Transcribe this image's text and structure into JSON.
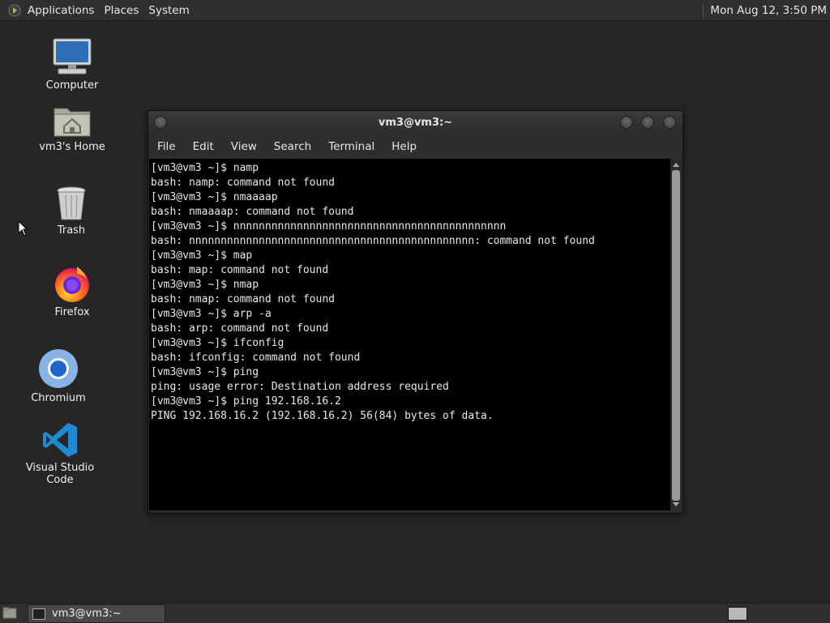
{
  "top_panel": {
    "menus": [
      "Applications",
      "Places",
      "System"
    ],
    "clock": "Mon Aug 12,  3:50 PM"
  },
  "desktop": {
    "icons": [
      {
        "label": "Computer",
        "icon": "computer-icon"
      },
      {
        "label": "vm3's Home",
        "icon": "home-folder-icon"
      },
      {
        "label": "Trash",
        "icon": "trash-icon"
      },
      {
        "label": "Firefox",
        "icon": "firefox-icon"
      },
      {
        "label": "Chromium",
        "icon": "chromium-icon"
      },
      {
        "label": "Visual Studio Code",
        "icon": "vscode-icon"
      }
    ]
  },
  "terminal": {
    "title": "vm3@vm3:~",
    "menu": [
      "File",
      "Edit",
      "View",
      "Search",
      "Terminal",
      "Help"
    ],
    "lines": [
      "[vm3@vm3 ~]$ namp",
      "bash: namp: command not found",
      "[vm3@vm3 ~]$ nmaaaap",
      "bash: nmaaaap: command not found",
      "[vm3@vm3 ~]$ nnnnnnnnnnnnnnnnnnnnnnnnnnnnnnnnnnnnnnnnnnn",
      "bash: nnnnnnnnnnnnnnnnnnnnnnnnnnnnnnnnnnnnnnnnnnnnn: command not found",
      "[vm3@vm3 ~]$ map",
      "bash: map: command not found",
      "[vm3@vm3 ~]$ nmap",
      "bash: nmap: command not found",
      "[vm3@vm3 ~]$ arp -a",
      "bash: arp: command not found",
      "[vm3@vm3 ~]$ ifconfig",
      "bash: ifconfig: command not found",
      "[vm3@vm3 ~]$ ping",
      "ping: usage error: Destination address required",
      "[vm3@vm3 ~]$ ping 192.168.16.2",
      "PING 192.168.16.2 (192.168.16.2) 56(84) bytes of data."
    ]
  },
  "taskbar": {
    "task_label": "vm3@vm3:~"
  }
}
